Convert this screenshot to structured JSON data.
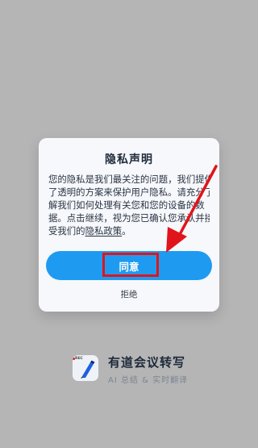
{
  "dialog": {
    "title": "隐私声明",
    "body_lines": [
      "您的隐私是我们最关注的问题，我们提供",
      "了透明的方案来保护用户隐私。请充分了",
      "解我们如何处理有关您和您的设备的数",
      "据。点击继续，视为您已确认您承认并接",
      "受我们的"
    ],
    "policy_link_label": "隐私政策",
    "body_end": "。",
    "agree_label": "同意",
    "decline_label": "拒绝"
  },
  "brand": {
    "app_name": "有道会议转写",
    "tagline": "AI 总结 & 实时翻译",
    "icon_tag": "REC"
  },
  "colors": {
    "overlay": "#b5b5b5",
    "dialog_bg": "#f6f8fb",
    "primary_button": "#1e9bf1",
    "annotation_red": "#e2141b"
  }
}
